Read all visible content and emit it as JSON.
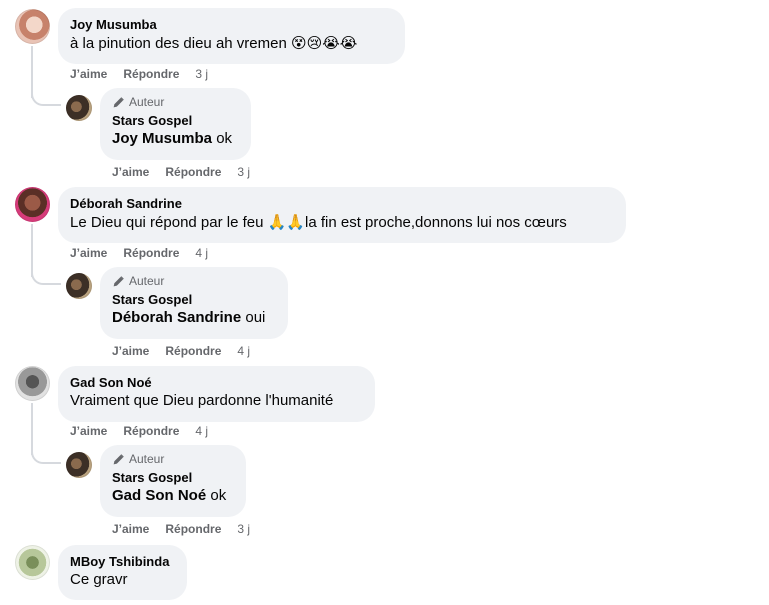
{
  "comments": [
    {
      "author": "Joy Musumba",
      "text": "à la pinution des dieu ah vremen",
      "emojis": "😵😢😭😭",
      "like": "J’aime",
      "reply": "Répondre",
      "time": "3 j",
      "reply_item": {
        "badge": "Auteur",
        "author": "Stars Gospel",
        "mention": "Joy Musumba",
        "text": " ok",
        "like": "J’aime",
        "reply": "Répondre",
        "time": "3 j"
      }
    },
    {
      "author": "Déborah Sandrine",
      "text_before": "Le Dieu qui répond par le feu ",
      "emojis": "🙏🙏",
      "text_after": "la fin est proche,donnons lui nos cœurs",
      "like": "J’aime",
      "reply": "Répondre",
      "time": "4 j",
      "reply_item": {
        "badge": "Auteur",
        "author": "Stars Gospel",
        "mention": "Déborah Sandrine",
        "text": " oui",
        "like": "J’aime",
        "reply": "Répondre",
        "time": "4 j"
      }
    },
    {
      "author": "Gad Son Noé",
      "text": "Vraiment que Dieu pardonne l'humanité",
      "like": "J’aime",
      "reply": "Répondre",
      "time": "4 j",
      "reply_item": {
        "badge": "Auteur",
        "author": "Stars Gospel",
        "mention": "Gad Son Noé",
        "text": " ok",
        "like": "J’aime",
        "reply": "Répondre",
        "time": "3 j"
      }
    },
    {
      "author": "MBoy Tshibinda",
      "text": "Ce gravr"
    }
  ],
  "colors": {
    "bubble": "#f0f2f5",
    "secondary_text": "#65676b",
    "thread_line": "#d6d9de"
  },
  "icons": {
    "author_badge": "pencil-icon"
  }
}
